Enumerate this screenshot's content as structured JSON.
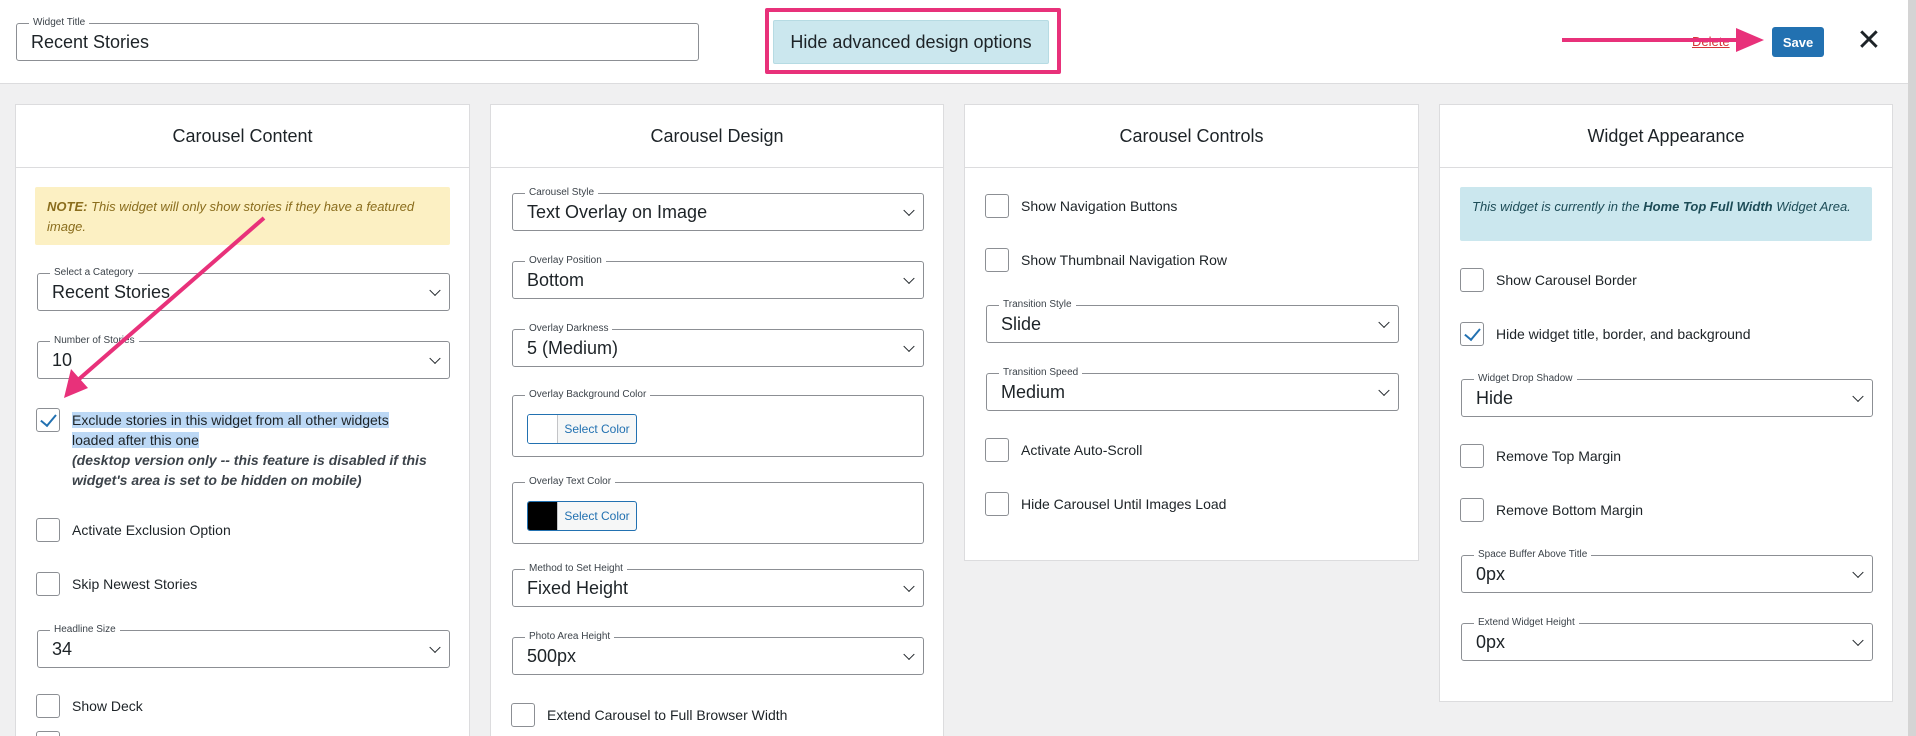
{
  "topbar": {
    "title_legend": "Widget Title",
    "title_value": "Recent Stories",
    "advanced_toggle": "Hide advanced design options",
    "delete_label": "Delete",
    "save_label": "Save",
    "close_glyph": "✕"
  },
  "panels": {
    "content": {
      "title": "Carousel Content",
      "notice_prefix": "NOTE:",
      "notice_text": " This widget will only show stories if they have a featured image.",
      "category_legend": "Select a Category",
      "category_value": "Recent Stories",
      "number_legend": "Number of Stories",
      "number_value": "10",
      "exclude_label": "Exclude stories in this widget from all other widgets loaded after this one",
      "exclude_note": "(desktop version only -- this feature is disabled if this widget's area is set to be hidden on mobile)",
      "exclude_checked": true,
      "activate_exclusion": "Activate Exclusion Option",
      "skip_newest": "Skip Newest Stories",
      "headline_legend": "Headline Size",
      "headline_value": "34",
      "show_deck": "Show Deck"
    },
    "design": {
      "title": "Carousel Design",
      "style_legend": "Carousel Style",
      "style_value": "Text Overlay on Image",
      "position_legend": "Overlay Position",
      "position_value": "Bottom",
      "darkness_legend": "Overlay Darkness",
      "darkness_value": "5 (Medium)",
      "bg_color_legend": "Overlay Background Color",
      "bg_color_btn": "Select Color",
      "bg_color_swatch": "#ffffff",
      "text_color_legend": "Overlay Text Color",
      "text_color_btn": "Select Color",
      "text_color_swatch": "#000000",
      "height_method_legend": "Method to Set Height",
      "height_method_value": "Fixed Height",
      "photo_height_legend": "Photo Area Height",
      "photo_height_value": "500px",
      "extend_full": "Extend Carousel to Full Browser Width"
    },
    "controls": {
      "title": "Carousel Controls",
      "show_nav": "Show Navigation Buttons",
      "show_thumb": "Show Thumbnail Navigation Row",
      "transition_style_legend": "Transition Style",
      "transition_style_value": "Slide",
      "transition_speed_legend": "Transition Speed",
      "transition_speed_value": "Medium",
      "auto_scroll": "Activate Auto-Scroll",
      "hide_until_load": "Hide Carousel Until Images Load"
    },
    "appearance": {
      "title": "Widget Appearance",
      "info_prefix": "This widget is currently in the ",
      "info_area": "Home Top Full Width",
      "info_suffix": " Widget Area.",
      "show_border": "Show Carousel Border",
      "hide_title": "Hide widget title, border, and background",
      "hide_title_checked": true,
      "shadow_legend": "Widget Drop Shadow",
      "shadow_value": "Hide",
      "remove_top": "Remove Top Margin",
      "remove_bottom": "Remove Bottom Margin",
      "buffer_legend": "Space Buffer Above Title",
      "buffer_value": "0px",
      "extend_legend": "Extend Widget Height",
      "extend_value": "0px"
    }
  },
  "colors": {
    "accent": "#2271b1",
    "highlight_pink": "#e8317a",
    "notice_warn": "#fcf0c3",
    "notice_info": "#cbe7ee"
  }
}
